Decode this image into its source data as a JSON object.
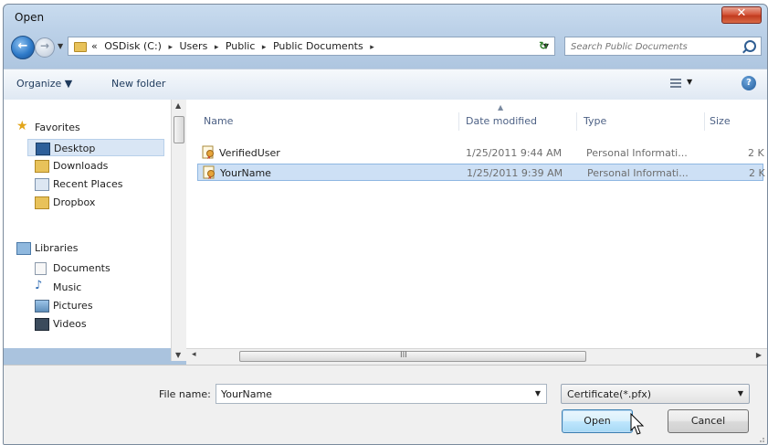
{
  "window": {
    "title": "Open",
    "close_label": "✕"
  },
  "address": {
    "crumbs": [
      "«",
      "OSDisk (C:)",
      "▸",
      "Users",
      "▸",
      "Public",
      "▸",
      "Public Documents",
      "▸"
    ],
    "search_placeholder": "Search Public Documents"
  },
  "toolbar": {
    "organize": "Organize ▼",
    "new_folder": "New folder",
    "help": "?"
  },
  "nav": {
    "favorites": "Favorites",
    "desktop": "Desktop",
    "downloads": "Downloads",
    "recent": "Recent Places",
    "dropbox": "Dropbox",
    "libraries": "Libraries",
    "documents": "Documents",
    "music": "Music",
    "pictures": "Pictures",
    "videos": "Videos"
  },
  "columns": {
    "name": "Name",
    "date": "Date modified",
    "type": "Type",
    "size": "Size"
  },
  "files": [
    {
      "name": "VerifiedUser",
      "date": "1/25/2011 9:44 AM",
      "type": "Personal Informati...",
      "size": "2 K"
    },
    {
      "name": "YourName",
      "date": "1/25/2011 9:39 AM",
      "type": "Personal Informati...",
      "size": "2 K"
    }
  ],
  "bottom": {
    "file_name_label": "File name:",
    "file_name_value": "YourName",
    "file_type": "Certificate(*.pfx)",
    "open": "Open",
    "cancel": "Cancel"
  },
  "scroll": {
    "grip": "III"
  }
}
